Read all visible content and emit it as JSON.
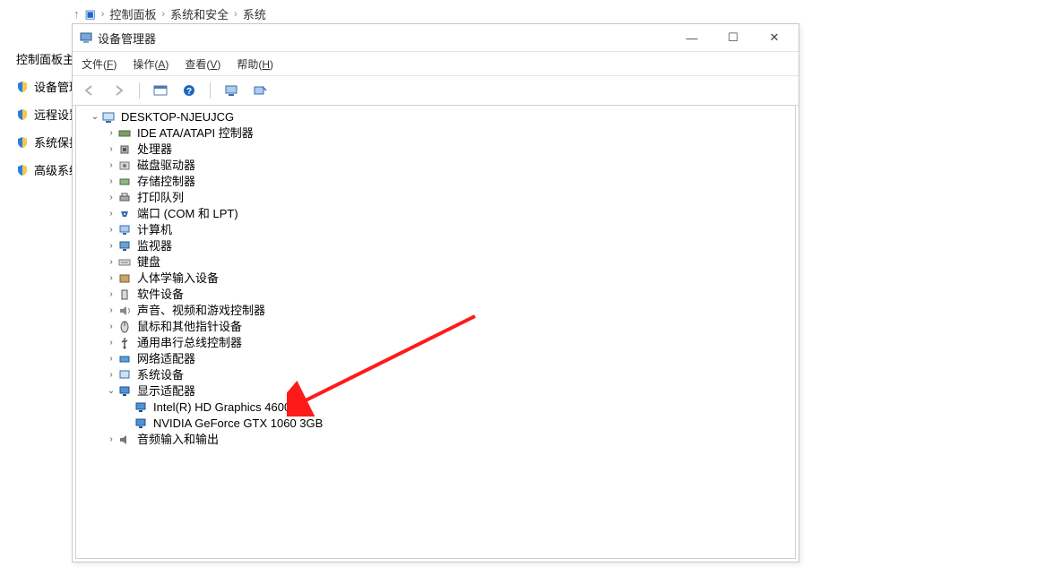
{
  "breadcrumb": {
    "root": "控制面板",
    "mid": "系统和安全",
    "leaf": "系统"
  },
  "sidebar": [
    {
      "label": "控制面板主页",
      "shield": false
    },
    {
      "label": "设备管理器",
      "shield": true
    },
    {
      "label": "远程设置",
      "shield": true
    },
    {
      "label": "系统保护",
      "shield": true
    },
    {
      "label": "高级系统设置",
      "shield": true
    }
  ],
  "dm": {
    "title": "设备管理器",
    "menus": [
      {
        "label": "文件",
        "accel": "F"
      },
      {
        "label": "操作",
        "accel": "A"
      },
      {
        "label": "查看",
        "accel": "V"
      },
      {
        "label": "帮助",
        "accel": "H"
      }
    ],
    "root": "DESKTOP-NJEUJCG",
    "categories": [
      {
        "icon": "ide",
        "label": "IDE ATA/ATAPI 控制器",
        "expanded": false
      },
      {
        "icon": "cpu",
        "label": "处理器",
        "expanded": false
      },
      {
        "icon": "disk",
        "label": "磁盘驱动器",
        "expanded": false
      },
      {
        "icon": "storage",
        "label": "存储控制器",
        "expanded": false
      },
      {
        "icon": "printer",
        "label": "打印队列",
        "expanded": false
      },
      {
        "icon": "port",
        "label": "端口 (COM 和 LPT)",
        "expanded": false
      },
      {
        "icon": "pc",
        "label": "计算机",
        "expanded": false
      },
      {
        "icon": "monitor",
        "label": "监视器",
        "expanded": false
      },
      {
        "icon": "keyboard",
        "label": "键盘",
        "expanded": false
      },
      {
        "icon": "hid",
        "label": "人体学输入设备",
        "expanded": false
      },
      {
        "icon": "soft",
        "label": "软件设备",
        "expanded": false
      },
      {
        "icon": "sound",
        "label": "声音、视频和游戏控制器",
        "expanded": false
      },
      {
        "icon": "mouse",
        "label": "鼠标和其他指针设备",
        "expanded": false
      },
      {
        "icon": "usb",
        "label": "通用串行总线控制器",
        "expanded": false
      },
      {
        "icon": "net",
        "label": "网络适配器",
        "expanded": false
      },
      {
        "icon": "sys",
        "label": "系统设备",
        "expanded": false
      },
      {
        "icon": "display",
        "label": "显示适配器",
        "expanded": true,
        "children": [
          {
            "icon": "display",
            "label": "Intel(R) HD Graphics 4600"
          },
          {
            "icon": "display",
            "label": "NVIDIA GeForce GTX 1060 3GB"
          }
        ]
      },
      {
        "icon": "audio",
        "label": "音频输入和输出",
        "expanded": false
      }
    ]
  }
}
